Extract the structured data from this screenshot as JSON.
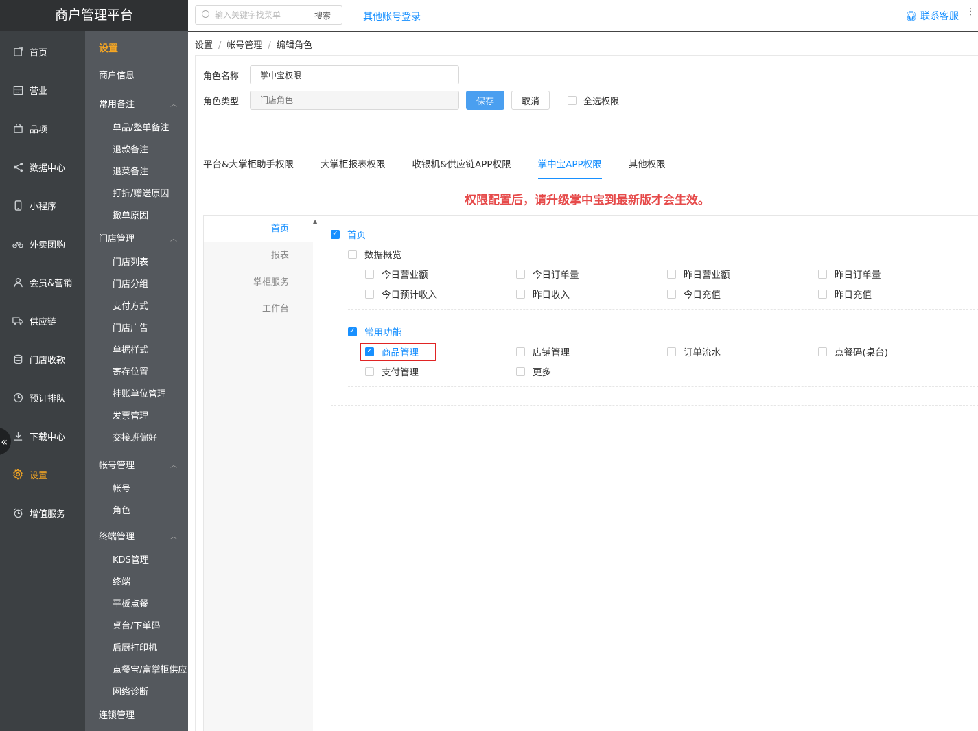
{
  "brand": "商户管理平台",
  "header": {
    "search_placeholder": "输入关键字找菜单",
    "search_btn": "搜索",
    "other_login": "其他账号登录",
    "contact": "联系客服"
  },
  "nav1": [
    {
      "label": "首页",
      "icon": "home-icon"
    },
    {
      "label": "营业",
      "icon": "calendar-icon"
    },
    {
      "label": "品项",
      "icon": "bag-icon"
    },
    {
      "label": "数据中心",
      "icon": "share-icon"
    },
    {
      "label": "小程序",
      "icon": "phone-icon"
    },
    {
      "label": "外卖团购",
      "icon": "bike-icon"
    },
    {
      "label": "会员&营销",
      "icon": "user-icon"
    },
    {
      "label": "供应链",
      "icon": "truck-icon"
    },
    {
      "label": "门店收款",
      "icon": "coins-icon"
    },
    {
      "label": "预订排队",
      "icon": "clock-icon"
    },
    {
      "label": "下载中心",
      "icon": "download-icon"
    },
    {
      "label": "设置",
      "icon": "gear-icon"
    },
    {
      "label": "增值服务",
      "icon": "alarm-icon"
    }
  ],
  "nav2": {
    "title": "设置",
    "merchant_info": "商户信息",
    "groups": [
      {
        "label": "常用备注",
        "items": [
          "单品/整单备注",
          "退款备注",
          "退菜备注",
          "打折/赠送原因",
          "撤单原因"
        ]
      },
      {
        "label": "门店管理",
        "items": [
          "门店列表",
          "门店分组",
          "支付方式",
          "门店广告",
          "单据样式",
          "寄存位置",
          "挂账单位管理",
          "发票管理",
          "交接班偏好"
        ]
      },
      {
        "label": "帐号管理",
        "items": [
          "帐号",
          "角色"
        ]
      },
      {
        "label": "终端管理",
        "items": [
          "KDS管理",
          "终端",
          "平板点餐",
          "桌台/下单码",
          "后厨打印机",
          "点餐宝/富掌柜供应",
          "网络诊断"
        ]
      }
    ],
    "chain": "连锁管理"
  },
  "breadcrumb": [
    "设置",
    "帐号管理",
    "编辑角色"
  ],
  "form": {
    "role_name_label": "角色名称",
    "role_name_value": "掌中宝权限",
    "role_type_label": "角色类型",
    "role_type_placeholder": "门店角色",
    "save": "保存",
    "cancel": "取消",
    "select_all": "全选权限"
  },
  "tabs": [
    "平台&大掌柜助手权限",
    "大掌柜报表权限",
    "收银机&供应链APP权限",
    "掌中宝APP权限",
    "其他权限"
  ],
  "notice": "权限配置后，请升级掌中宝到最新版才会生效。",
  "perm_side": [
    "首页",
    "报表",
    "掌柜服务",
    "工作台"
  ],
  "perm": {
    "root": "首页",
    "overview": {
      "label": "数据概览",
      "items": [
        "今日营业额",
        "今日订单量",
        "昨日营业额",
        "昨日订单量",
        "今日预计收入",
        "昨日收入",
        "今日充值",
        "昨日充值"
      ]
    },
    "common": {
      "label": "常用功能",
      "items": [
        "商品管理",
        "店铺管理",
        "订单流水",
        "点餐码(桌台)",
        "支付管理",
        "更多"
      ]
    }
  }
}
